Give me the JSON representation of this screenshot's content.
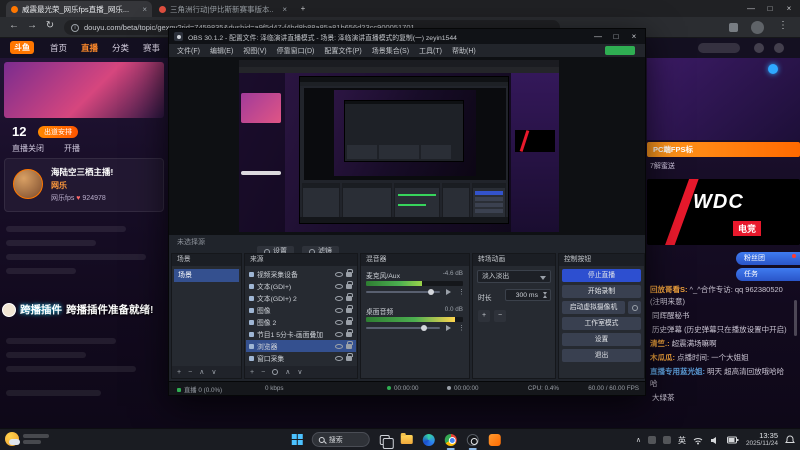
{
  "browser": {
    "tab1": "威震最光荣_网乐fps直播_网乐...",
    "tab2": "三角洲行动|伊比斯新赛事版本...",
    "url": "douyu.com/beta/topic/gexgy?rid=7459835&dyshid=a9f5d47-f4bd8b88a85a81b656d23cc900051701"
  },
  "douyu": {
    "logo": "斗鱼",
    "nav": [
      "首页",
      "直播",
      "分类",
      "赛事"
    ],
    "left": {
      "count": "12",
      "badge": "出道安排",
      "toggle_off": "直播关闭",
      "toggle_on": "开播",
      "card_title": "海陆空三栖主播!",
      "streamer": "网乐",
      "streamer_id": "网乐fps",
      "fans": "924978"
    },
    "overlay": {
      "name": "跨播插件",
      "msg": "跨播插件准备就绪!"
    },
    "right": {
      "promo": "PC端FPS标",
      "promo_small": "7解蜜送",
      "wdc": "WDC",
      "wdc_sub": "电竞",
      "pill1": "粉丝团",
      "pill2": "任务",
      "chat": [
        {
          "name": "回放哥看S:",
          "text": "^_^合作专访: qq 962380520 (注明来意)",
          "color": "#f0a23c"
        },
        {
          "name": "",
          "text": "同辉醒秘书",
          "color": "#9b93a8"
        },
        {
          "name": "",
          "text": "历史弹幕 (历史弹幕只在播放设置中开启)",
          "color": "#8a8f98"
        },
        {
          "name": "清竺.:",
          "text": "超震满场嘛啊",
          "color": "#f0a23c"
        },
        {
          "name": "木瓜瓜:",
          "text": "点播时间: 一个大姐姐",
          "color": "#f0a23c"
        },
        {
          "name": "直播专用蓝光姐:",
          "text": "明天 超高清回放哦哈哈哈",
          "color": "#5b9bd5"
        },
        {
          "name": "",
          "text": "大绿茶",
          "color": "#7ec46a"
        }
      ]
    }
  },
  "obs": {
    "title": "OBS 30.1.2 - 配置文件: 泽临演讲直播模式 - 场景: 泽临演讲直播模式的复制(一) zeyin1544",
    "menu": [
      "文件(F)",
      "编辑(E)",
      "视图(V)",
      "停靠窗口(D)",
      "配置文件(P)",
      "场景集合(S)",
      "工具(T)",
      "帮助(H)"
    ],
    "no_source": "未选择源",
    "btn_settings": "设置",
    "btn_filters": "滤镜",
    "scenes": {
      "title": "场景",
      "rows": [
        {
          "name": "场景",
          "cls": "sel"
        }
      ]
    },
    "sources": {
      "title": "来源",
      "rows": [
        {
          "name": "视频采集设备"
        },
        {
          "name": "文本(GDI+)"
        },
        {
          "name": "文本(GDI+) 2"
        },
        {
          "name": "图像"
        },
        {
          "name": "图像 2"
        },
        {
          "name": "节目1 5分卡-画面叠加"
        },
        {
          "name": "浏览器",
          "cls": "sel"
        },
        {
          "name": "窗口采集"
        }
      ]
    },
    "mixer": {
      "title": "混音器",
      "ch1": {
        "name": "麦克风/Aux",
        "db": "-4.6 dB"
      },
      "ch2": {
        "name": "桌面音频",
        "db": "0.0 dB"
      }
    },
    "transitions": {
      "title": "转场动画",
      "type": "淡入淡出",
      "duration_label": "时长",
      "duration": "300 ms"
    },
    "controls": {
      "title": "控制按钮",
      "b1": "停止直播",
      "b2": "开始录制",
      "b3": "启动虚拟摄像机",
      "b4": "工作室模式",
      "b5": "设置",
      "b6": "退出"
    },
    "status": {
      "dropped": "直播 0 (0.0%)",
      "bitrate": "0 kbps",
      "rec_time": "00:00:00",
      "live_time": "00:00:00",
      "cpu": "CPU: 0.4%",
      "fps": "60.00 / 60.00 FPS"
    }
  },
  "taskbar": {
    "search": "搜索",
    "lang": "英",
    "time": "13:35",
    "date": "2025/11/24"
  }
}
